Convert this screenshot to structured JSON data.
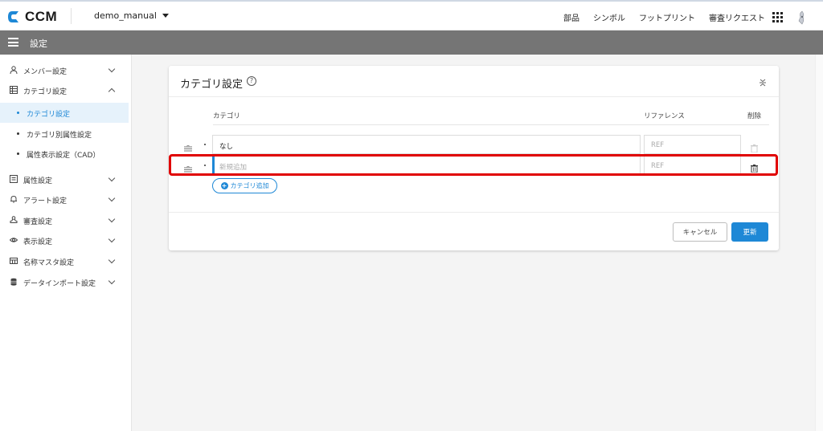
{
  "header": {
    "logo_text": "CCM",
    "project_name": "demo_manual",
    "nav": [
      "部品",
      "シンボル",
      "フットプリント",
      "審査リクエスト"
    ],
    "accent": "#1e88d6"
  },
  "settings_bar": {
    "title": "設定"
  },
  "sidebar": {
    "items": [
      {
        "label": "メンバー設定",
        "icon": "person-icon",
        "expanded": false
      },
      {
        "label": "カテゴリ設定",
        "icon": "list-icon",
        "expanded": true
      },
      {
        "label": "属性設定",
        "icon": "document-icon",
        "expanded": false
      },
      {
        "label": "アラート設定",
        "icon": "bell-icon",
        "expanded": false
      },
      {
        "label": "審査設定",
        "icon": "stamp-icon",
        "expanded": false
      },
      {
        "label": "表示設定",
        "icon": "eye-icon",
        "expanded": false
      },
      {
        "label": "名称マスタ設定",
        "icon": "table-icon",
        "expanded": false
      },
      {
        "label": "データインポート設定",
        "icon": "database-icon",
        "expanded": false
      }
    ],
    "subitems": [
      {
        "label": "カテゴリ設定",
        "active": true
      },
      {
        "label": "カテゴリ別属性設定",
        "active": false
      },
      {
        "label": "属性表示設定（CAD）",
        "active": false
      }
    ]
  },
  "card": {
    "title": "カテゴリ設定",
    "columns": {
      "category": "カテゴリ",
      "reference": "リファレンス",
      "delete": "削除"
    },
    "rows": [
      {
        "category": "なし",
        "reference_placeholder": "REF"
      },
      {
        "category_placeholder": "新規追加",
        "reference_placeholder": "REF"
      }
    ],
    "add_button": "カテゴリ追加",
    "cancel_button": "キャンセル",
    "update_button": "更新"
  }
}
